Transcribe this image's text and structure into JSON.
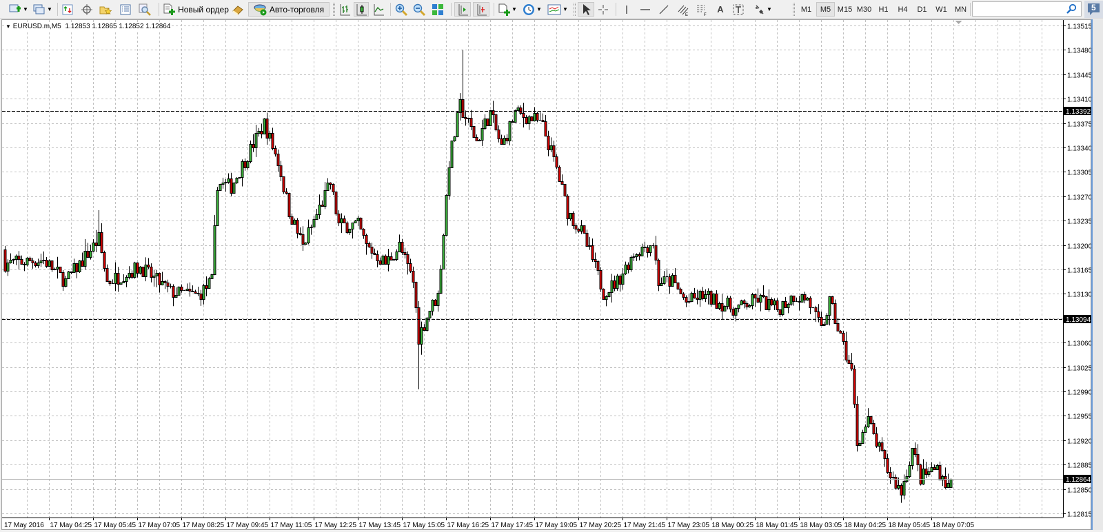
{
  "toolbar": {
    "new_order_label": "Новый ордер",
    "autotrading_label": "Авто-торговля",
    "timeframes": [
      "M1",
      "M5",
      "M15",
      "M30",
      "H1",
      "H4",
      "D1",
      "W1",
      "MN"
    ],
    "active_timeframe": "M5",
    "search_placeholder": "",
    "messages_count": "5"
  },
  "chart_header": {
    "symbol": "EURUSD.m,M5",
    "ohlc": "1.12853 1.12865 1.12852 1.12864"
  },
  "colors": {
    "bull": "#3cb83c",
    "bear": "#dd0000",
    "grid": "#c0c0c0",
    "background": "#ffffff"
  },
  "chart_data": {
    "type": "candlestick",
    "symbol": "EURUSD.m",
    "timeframe": "M5",
    "bar_count": 344,
    "ylim": [
      1.12815,
      1.13515
    ],
    "y_ticks": [
      "1.13515",
      "1.13480",
      "1.13445",
      "1.13410",
      "1.13375",
      "1.13340",
      "1.13305",
      "1.13270",
      "1.13235",
      "1.13200",
      "1.13165",
      "1.13130",
      "1.13095",
      "1.13060",
      "1.13025",
      "1.12990",
      "1.12955",
      "1.12920",
      "1.12885",
      "1.12850",
      "1.12815"
    ],
    "x_ticks": [
      "17 May 2016",
      "17 May 04:25",
      "17 May 05:45",
      "17 May 07:05",
      "17 May 08:25",
      "17 May 09:45",
      "17 May 11:05",
      "17 May 12:25",
      "17 May 13:45",
      "17 May 15:05",
      "17 May 16:25",
      "17 May 17:45",
      "17 May 19:05",
      "17 May 20:25",
      "17 May 21:45",
      "17 May 23:05",
      "18 May 00:25",
      "18 May 01:45",
      "18 May 03:05",
      "18 May 04:25",
      "18 May 05:45",
      "18 May 07:05"
    ],
    "bars_per_x_tick": 16,
    "close_path": [
      [
        0,
        1.13174
      ],
      [
        14,
        1.13179
      ],
      [
        22,
        1.13148
      ],
      [
        34,
        1.13209
      ],
      [
        37,
        1.13148
      ],
      [
        49,
        1.13169
      ],
      [
        60,
        1.13133
      ],
      [
        70,
        1.13128
      ],
      [
        75,
        1.13148
      ],
      [
        77,
        1.13289
      ],
      [
        82,
        1.13284
      ],
      [
        88,
        1.1333
      ],
      [
        94,
        1.13375
      ],
      [
        99,
        1.1332
      ],
      [
        103,
        1.13249
      ],
      [
        108,
        1.13199
      ],
      [
        118,
        1.13289
      ],
      [
        121,
        1.13229
      ],
      [
        128,
        1.13229
      ],
      [
        131,
        1.13199
      ],
      [
        138,
        1.13174
      ],
      [
        143,
        1.13199
      ],
      [
        148,
        1.13148
      ],
      [
        150,
        1.13068
      ],
      [
        154,
        1.13108
      ],
      [
        157,
        1.13128
      ],
      [
        159,
        1.13219
      ],
      [
        161,
        1.1332
      ],
      [
        165,
        1.134
      ],
      [
        171,
        1.1335
      ],
      [
        176,
        1.1339
      ],
      [
        180,
        1.1334
      ],
      [
        185,
        1.1339
      ],
      [
        192,
        1.1338
      ],
      [
        195,
        1.1337
      ],
      [
        200,
        1.1331
      ],
      [
        204,
        1.13249
      ],
      [
        209,
        1.13219
      ],
      [
        213,
        1.13179
      ],
      [
        217,
        1.13133
      ],
      [
        222,
        1.13148
      ],
      [
        228,
        1.13189
      ],
      [
        235,
        1.13204
      ],
      [
        237,
        1.13148
      ],
      [
        242,
        1.13148
      ],
      [
        247,
        1.13118
      ],
      [
        253,
        1.13128
      ],
      [
        265,
        1.13108
      ],
      [
        273,
        1.13123
      ],
      [
        280,
        1.13108
      ],
      [
        286,
        1.13128
      ],
      [
        291,
        1.13123
      ],
      [
        296,
        1.13078
      ],
      [
        299,
        1.13118
      ],
      [
        303,
        1.13068
      ],
      [
        307,
        1.13018
      ],
      [
        309,
        1.12917
      ],
      [
        313,
        1.12947
      ],
      [
        317,
        1.12907
      ],
      [
        320,
        1.12877
      ],
      [
        325,
        1.12846
      ],
      [
        329,
        1.12907
      ],
      [
        332,
        1.12866
      ],
      [
        338,
        1.12882
      ],
      [
        342,
        1.12853
      ],
      [
        343,
        1.12864
      ]
    ],
    "extremes": [
      [
        166,
        "high",
        1.1348
      ],
      [
        150,
        "low",
        1.12993
      ],
      [
        34,
        "high",
        1.1325
      ]
    ],
    "last_bar": {
      "open": 1.12853,
      "high": 1.12865,
      "low": 1.12852,
      "close": 1.12864
    },
    "horizontal_lines": [
      {
        "price": "1.13392",
        "style": "dashed"
      },
      {
        "price": "1.13094",
        "style": "dashed"
      }
    ],
    "bid_line": {
      "price": "1.12864"
    }
  }
}
